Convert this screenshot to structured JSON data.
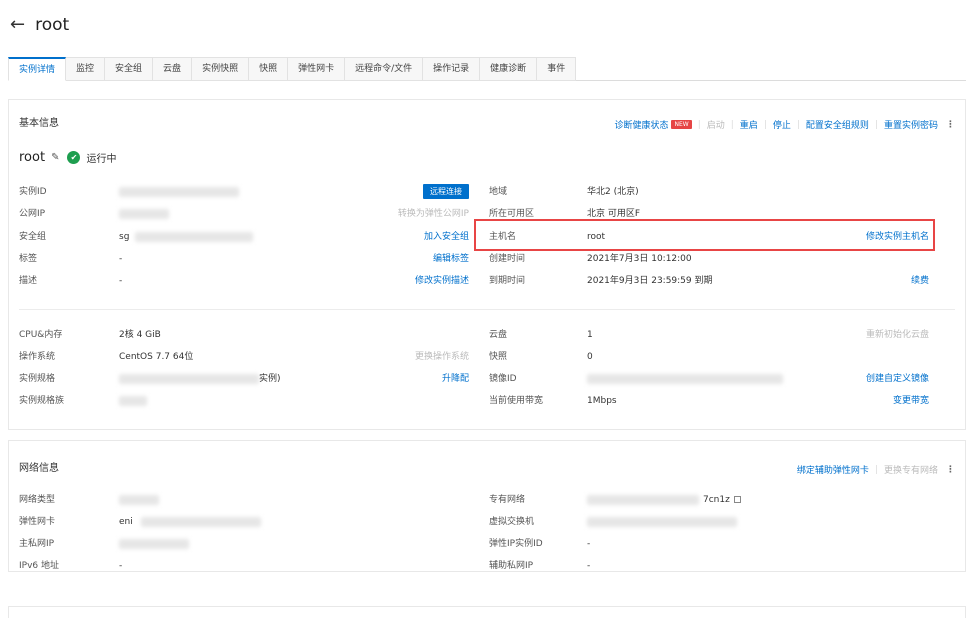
{
  "header": {
    "back_icon": "arrow-left-icon",
    "title": "root"
  },
  "tabs": [
    {
      "label": "实例详情",
      "active": true
    },
    {
      "label": "监控"
    },
    {
      "label": "安全组"
    },
    {
      "label": "云盘"
    },
    {
      "label": "实例快照"
    },
    {
      "label": "快照"
    },
    {
      "label": "弹性网卡"
    },
    {
      "label": "远程命令/文件"
    },
    {
      "label": "操作记录"
    },
    {
      "label": "健康诊断"
    },
    {
      "label": "事件"
    }
  ],
  "basic": {
    "heading": "基本信息",
    "actions": {
      "diagnose": "诊断健康状态",
      "new_badge": "NEW",
      "start": "启动",
      "restart": "重启",
      "stop": "停止",
      "sg_rules": "配置安全组规则",
      "reset_pwd": "重置实例密码",
      "more": "⋮"
    },
    "instance_name": "root",
    "status": "运行中",
    "left": {
      "instance_id_label": "实例ID",
      "public_ip_label": "公网IP",
      "security_group_label": "安全组",
      "security_group_value": "sg",
      "tags_label": "标签",
      "tags_value": "-",
      "desc_label": "描述",
      "desc_value": "-",
      "remote_connect": "远程连接",
      "convert_eip": "转换为弹性公网IP",
      "join_sg": "加入安全组",
      "edit_tags": "编辑标签",
      "edit_desc": "修改实例描述"
    },
    "right": {
      "region_label": "地域",
      "region_value": "华北2 (北京)",
      "zone_label": "所在可用区",
      "zone_value": "北京 可用区F",
      "hostname_label": "主机名",
      "hostname_value": "root",
      "edit_hostname": "修改实例主机名",
      "created_label": "创建时间",
      "created_value": "2021年7月3日 10:12:00",
      "expire_label": "到期时间",
      "expire_value": "2021年9月3日 23:59:59 到期",
      "renew": "续费"
    },
    "spec_left": {
      "cpu_label": "CPU&内存",
      "cpu_value": "2核 4 GiB",
      "os_label": "操作系统",
      "os_value": "CentOS 7.7 64位",
      "change_os": "更换操作系统",
      "type_label": "实例规格",
      "type_value": "实例)",
      "upgrade": "升降配",
      "family_label": "实例规格族"
    },
    "spec_right": {
      "disk_label": "云盘",
      "disk_value": "1",
      "reinit_disk": "重新初始化云盘",
      "snap_label": "快照",
      "snap_value": "0",
      "image_label": "镜像ID",
      "create_image": "创建自定义镜像",
      "bw_label": "当前使用带宽",
      "bw_value": "1Mbps",
      "change_bw": "变更带宽"
    }
  },
  "network": {
    "heading": "网络信息",
    "actions": {
      "bind_eni": "绑定辅助弹性网卡",
      "change_vpc": "更换专有网络",
      "more": "⋮"
    },
    "left": {
      "net_type_label": "网络类型",
      "eni_label": "弹性网卡",
      "eni_value": "eni",
      "private_ip_label": "主私网IP",
      "ipv6_label": "IPv6 地址",
      "ipv6_value": "-"
    },
    "right": {
      "vpc_label": "专有网络",
      "vpc_value": "7cn1z",
      "vswitch_label": "虚拟交换机",
      "eip_label": "弹性IP实例ID",
      "eip_value": "-",
      "secondary_ip_label": "辅助私网IP",
      "secondary_ip_value": "-"
    }
  },
  "colors": {
    "accent": "#0070cc",
    "success": "#1e9e4f",
    "highlight": "#e84545"
  }
}
